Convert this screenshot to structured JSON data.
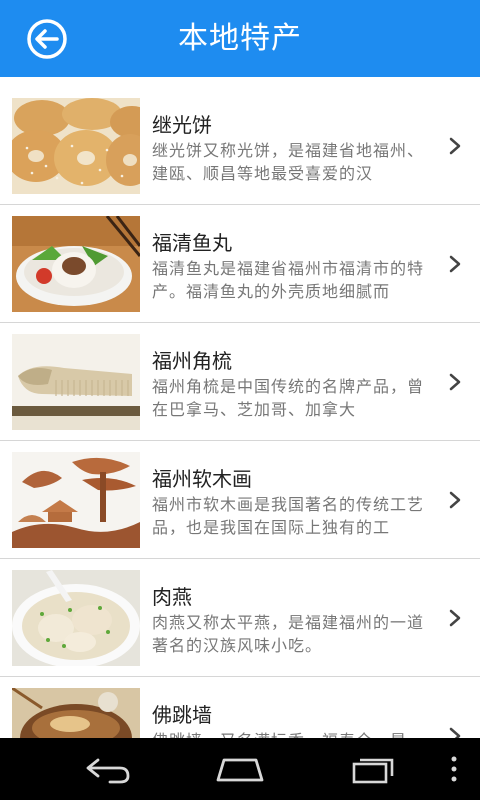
{
  "header": {
    "title": "本地特产",
    "back_icon": "arrow-left-circle-icon",
    "background": "#1e8cf0"
  },
  "items": [
    {
      "name": "继光饼",
      "desc": "继光饼又称光饼，是福建省地福州、建瓯、顺昌等地最受喜爱的汉"
    },
    {
      "name": "福清鱼丸",
      "desc": "福清鱼丸是福建省福州市福清市的特产。福清鱼丸的外壳质地细腻而"
    },
    {
      "name": "福州角梳",
      "desc": "福州角梳是中国传统的名牌产品，曾在巴拿马、芝加哥、加拿大"
    },
    {
      "name": "福州软木画",
      "desc": "福州市软木画是我国著名的传统工艺品，也是我国在国际上独有的工"
    },
    {
      "name": "肉燕",
      "desc": "肉燕又称太平燕，是福建福州的一道著名的汉族风味小吃。"
    },
    {
      "name": "佛跳墙",
      "desc": "佛跳墙，又名满坛香、福寿全，是"
    }
  ],
  "navbar": {
    "back": "back-arrow-icon",
    "home": "home-icon",
    "recents": "recent-apps-icon",
    "menu": "overflow-menu-icon"
  }
}
